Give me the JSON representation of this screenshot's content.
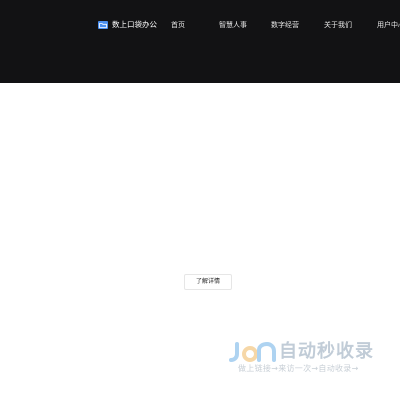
{
  "header": {
    "brand": {
      "icon": "folder-icon",
      "name": "数上口袋办公"
    },
    "nav": [
      {
        "label": "首页"
      },
      {
        "label": "智慧人事"
      },
      {
        "label": "数字经营"
      },
      {
        "label": "关于我们"
      },
      {
        "label": "用户中心"
      }
    ],
    "background_color": "#121214"
  },
  "main": {
    "cta_label": "了解详情"
  },
  "watermark": {
    "title": "自动秒收录",
    "subtitle": "做上链接→来访一次→自动收录→",
    "logo_color": "#6db0e6"
  }
}
